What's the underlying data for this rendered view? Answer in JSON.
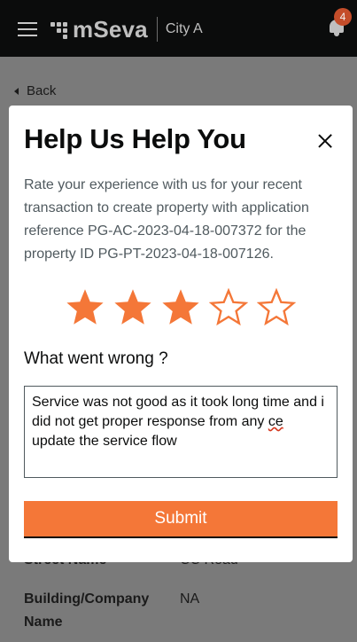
{
  "header": {
    "app_name": "mSeva",
    "city": "City A",
    "notification_count": "4"
  },
  "nav": {
    "back_label": "Back"
  },
  "background_details": [
    {
      "label": "Street Name",
      "value": "CC Road"
    },
    {
      "label": "Building/Company Name",
      "value": "NA"
    }
  ],
  "modal": {
    "title": "Help Us Help You",
    "description": "Rate your experience with us for your recent transaction to create property with application reference PG-AC-2023-04-18-007372 for the property ID PG-PT-2023-04-18-007126.",
    "rating": {
      "value": 3,
      "max": 5
    },
    "question": "What went wrong ?",
    "feedback_text": "Service was not good as it took long time and i did not get proper response from any ce update the service flow",
    "submit_label": "Submit"
  },
  "colors": {
    "accent": "#f47738",
    "header_bg": "#0b0c0c",
    "badge": "#c44d2a"
  }
}
